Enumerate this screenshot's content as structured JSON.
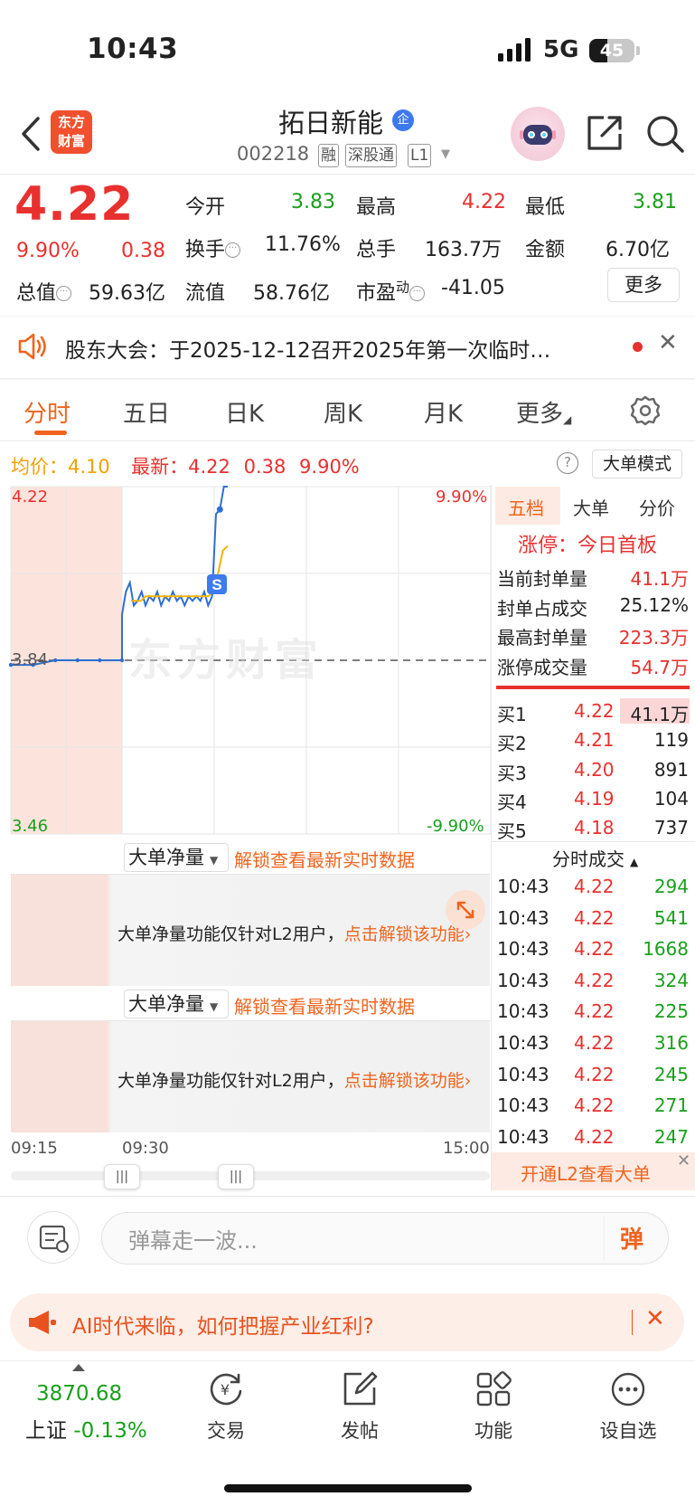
{
  "status_bar": {
    "time": "10:43",
    "network": "5G",
    "battery": "45"
  },
  "header": {
    "logo_line1": "东方",
    "logo_line2": "财富",
    "stock_name": "拓日新能",
    "badge": "企",
    "stock_code": "002218",
    "tags": [
      "融",
      "深股通",
      "L1"
    ]
  },
  "quote": {
    "price": "4.22",
    "change_pct": "9.90%",
    "change": "0.38",
    "open_label": "今开",
    "open_value": "3.83",
    "high_label": "最高",
    "high_value": "4.22",
    "low_label": "最低",
    "low_value": "3.81",
    "turnover_label": "换手",
    "turnover_value": "11.76%",
    "volume_label": "总手",
    "volume_value": "163.7万",
    "amount_label": "金额",
    "amount_value": "6.70亿",
    "mktcap_label": "总值",
    "mktcap_value": "59.63亿",
    "float_label": "流值",
    "float_value": "58.76亿",
    "pe_label": "市盈",
    "pe_sup": "动",
    "pe_value": "-41.05",
    "more_button": "更多"
  },
  "notice": {
    "text": "股东大会：于2025-12-12召开2025年第一次临时…"
  },
  "tabs": [
    "分时",
    "五日",
    "日K",
    "周K",
    "月K",
    "更多"
  ],
  "chart_info": {
    "avg_label": "均价：",
    "avg_value": "4.10",
    "latest_label": "最新：",
    "latest_value": "4.22",
    "latest_change": "0.38",
    "latest_pct": "9.90%",
    "help": "?",
    "big_order_mode": "大单模式"
  },
  "chart_data": {
    "type": "line",
    "y_top_label": "4.22",
    "y_mid_label": "3.84",
    "y_bottom_label": "3.46",
    "pct_top_label": "9.90%",
    "pct_bottom_label": "-9.90%",
    "ylim": [
      3.46,
      4.22
    ],
    "prev_close": 3.84,
    "watermark": "东方财富",
    "marker": "S",
    "x_labels": [
      "09:15",
      "09:30",
      "15:00"
    ],
    "series": [
      {
        "color": "#2f6fd0",
        "values": [
          3.83,
          3.83,
          3.84,
          3.84,
          3.84,
          3.84,
          3.94,
          3.99,
          4.01,
          3.96,
          3.97,
          3.99,
          3.96,
          3.98,
          3.97,
          3.99,
          3.96,
          3.98,
          3.97,
          3.99,
          3.97,
          3.98,
          3.96,
          3.98,
          3.97,
          3.98,
          3.97,
          3.99,
          3.96,
          3.98,
          4.16,
          4.17,
          4.22,
          4.22
        ]
      },
      {
        "color": "#f5b400",
        "values": [
          3.97,
          3.97,
          3.97,
          3.98,
          3.98,
          3.98,
          3.98,
          3.98,
          3.98,
          3.98,
          3.98,
          3.98,
          3.98,
          3.98,
          3.98,
          3.98,
          3.98,
          3.99,
          4.03,
          4.08,
          4.09
        ]
      }
    ]
  },
  "order_panel": {
    "tabs": [
      "五档",
      "大单",
      "分价"
    ],
    "limit_title": "涨停：今日首板",
    "stats": [
      {
        "label": "当前封单量",
        "value": "41.1万"
      },
      {
        "label": "封单占成交",
        "value": "25.12%"
      },
      {
        "label": "最高封单量",
        "value": "223.3万"
      },
      {
        "label": "涨停成交量",
        "value": "54.7万"
      }
    ],
    "bids": [
      {
        "label": "买1",
        "price": "4.22",
        "vol": "41.1万"
      },
      {
        "label": "买2",
        "price": "4.21",
        "vol": "119"
      },
      {
        "label": "买3",
        "price": "4.20",
        "vol": "891"
      },
      {
        "label": "买4",
        "price": "4.19",
        "vol": "104"
      },
      {
        "label": "买5",
        "price": "4.18",
        "vol": "737"
      }
    ],
    "trades_title": "分时成交",
    "trades": [
      {
        "time": "10:43",
        "price": "4.22",
        "vol": "294"
      },
      {
        "time": "10:43",
        "price": "4.22",
        "vol": "541"
      },
      {
        "time": "10:43",
        "price": "4.22",
        "vol": "1668"
      },
      {
        "time": "10:43",
        "price": "4.22",
        "vol": "324"
      },
      {
        "time": "10:43",
        "price": "4.22",
        "vol": "225"
      },
      {
        "time": "10:43",
        "price": "4.22",
        "vol": "316"
      },
      {
        "time": "10:43",
        "price": "4.22",
        "vol": "245"
      },
      {
        "time": "10:43",
        "price": "4.22",
        "vol": "271"
      },
      {
        "time": "10:43",
        "price": "4.22",
        "vol": "247"
      }
    ],
    "open_l2": "开通L2查看大单"
  },
  "large_order": {
    "select_label": "大单净量",
    "unlock_hint": "解锁查看最新实时数据",
    "notice_text": "大单净量功能仅针对L2用户，",
    "notice_link": "点击解锁该功能"
  },
  "comment": {
    "placeholder": "弹幕走一波...",
    "danmu": "弹"
  },
  "ai_banner": {
    "text": "AI时代来临，如何把握产业红利?"
  },
  "bottom_nav": {
    "index_value": "3870.68",
    "index_name": "上证",
    "index_change": "-0.13%",
    "items": [
      "交易",
      "发帖",
      "功能",
      "设自选"
    ]
  }
}
